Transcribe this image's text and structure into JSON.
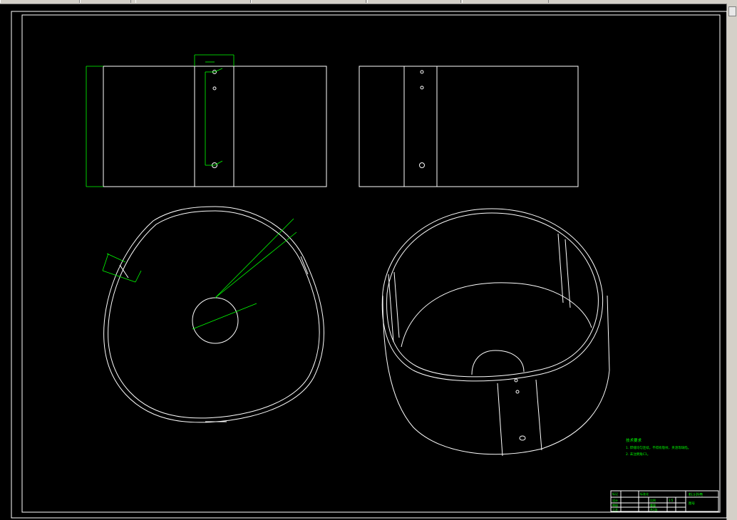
{
  "window": {
    "toolbar_segments": 6,
    "scrollbar": "vertical-scrollbar"
  },
  "colors": {
    "background": "#000000",
    "geometry": "#ffffff",
    "dimensions": "#00ff00",
    "ui_chrome": "#d4d0c8"
  },
  "views": {
    "front": "front-view",
    "side": "side-view",
    "top": "top-view",
    "iso": "isometric-view"
  },
  "notes": {
    "title": "技术要求",
    "line1": "1. 焊缝均匀连续，不得有裂纹、夹渣等缺陷。",
    "line2": "2. 未注倒角C1。"
  },
  "title_block": {
    "label1": "标记",
    "label2": "设计",
    "label3": "审核",
    "label4": "工艺",
    "label5": "标准化",
    "label6": "比例",
    "label7": "重量",
    "label8": "共1张",
    "scale": "1:5",
    "title": "料斗外壳",
    "drawing_no": "图号"
  }
}
